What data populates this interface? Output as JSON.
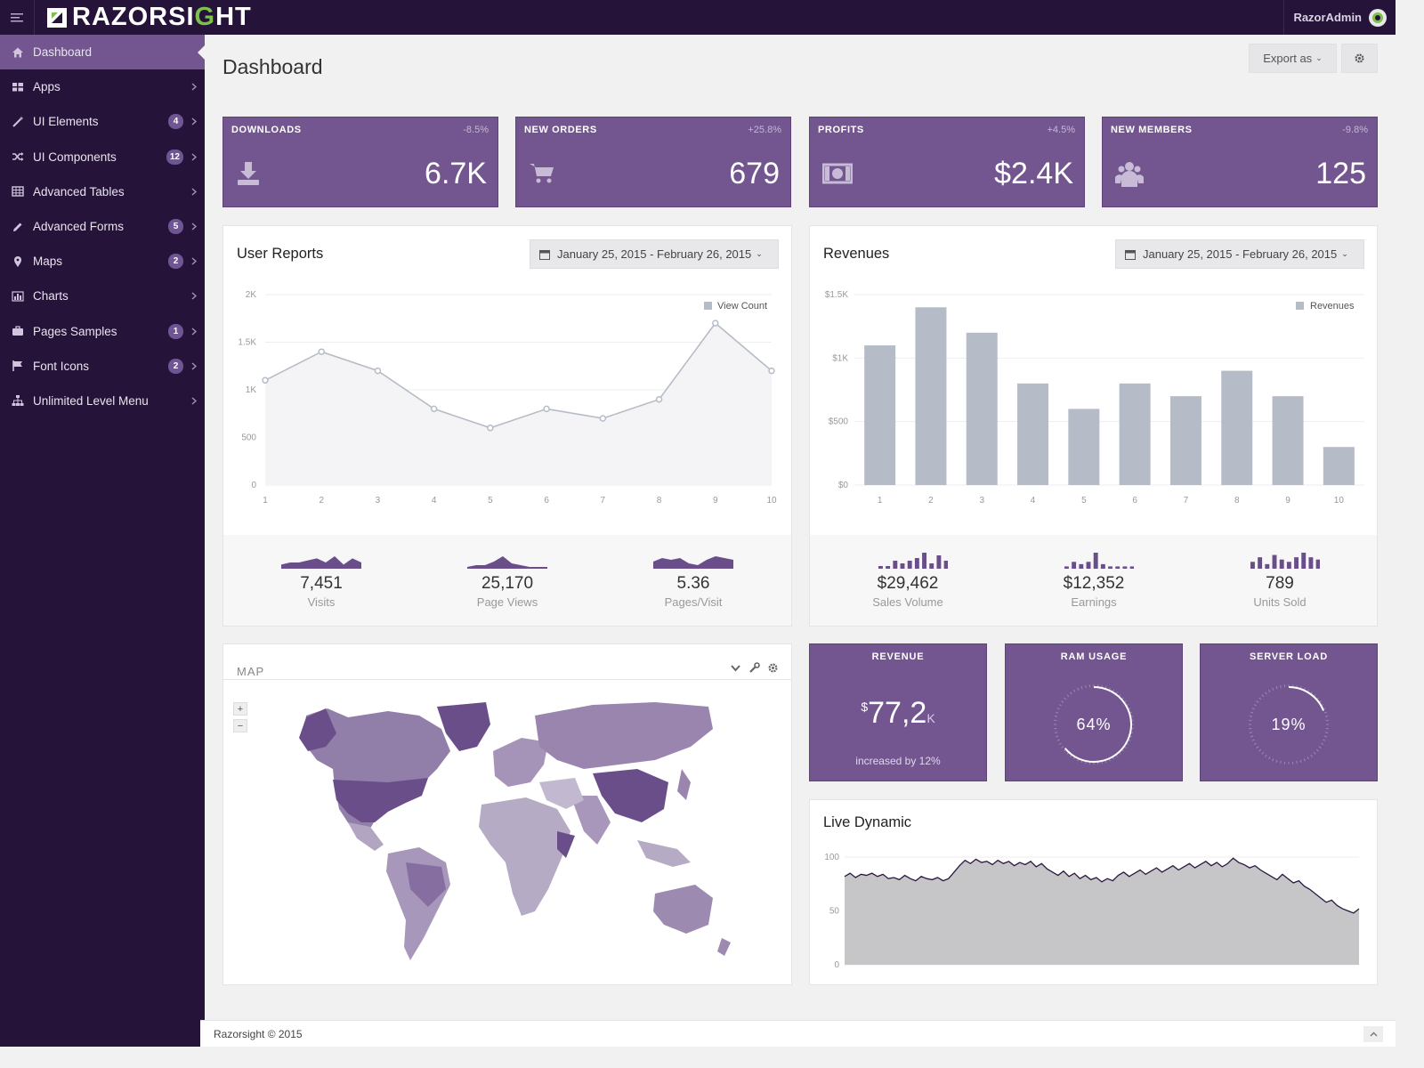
{
  "brand": {
    "name_pre": "RAZORSI",
    "name_g": "G",
    "name_post": "HT"
  },
  "user": {
    "name": "RazorAdmin"
  },
  "sidebar": {
    "items": [
      {
        "label": "Dashboard",
        "icon": "home-icon",
        "badge": "",
        "active": true
      },
      {
        "label": "Apps",
        "icon": "grid-icon",
        "badge": ""
      },
      {
        "label": "UI Elements",
        "icon": "magic-wand-icon",
        "badge": "4"
      },
      {
        "label": "UI Components",
        "icon": "shuffle-icon",
        "badge": "12"
      },
      {
        "label": "Advanced Tables",
        "icon": "table-icon",
        "badge": ""
      },
      {
        "label": "Advanced Forms",
        "icon": "pencil-icon",
        "badge": "5"
      },
      {
        "label": "Maps",
        "icon": "map-marker-icon",
        "badge": "2"
      },
      {
        "label": "Charts",
        "icon": "bar-chart-icon",
        "badge": ""
      },
      {
        "label": "Pages Samples",
        "icon": "briefcase-icon",
        "badge": "1"
      },
      {
        "label": "Font Icons",
        "icon": "flag-icon",
        "badge": "2"
      },
      {
        "label": "Unlimited Level Menu",
        "icon": "sitemap-icon",
        "badge": ""
      }
    ]
  },
  "header": {
    "title": "Dashboard",
    "export_label": "Export as"
  },
  "stats": [
    {
      "label": "DOWNLOADS",
      "change": "-8.5%",
      "value": "6.7K",
      "icon": "download-icon"
    },
    {
      "label": "NEW ORDERS",
      "change": "+25.8%",
      "value": "679",
      "icon": "cart-icon"
    },
    {
      "label": "PROFITS",
      "change": "+4.5%",
      "value": "$2.4K",
      "icon": "money-icon"
    },
    {
      "label": "NEW MEMBERS",
      "change": "-9.8%",
      "value": "125",
      "icon": "users-icon"
    }
  ],
  "user_reports": {
    "title": "User Reports",
    "date_range": "January 25, 2015 - February 26, 2015",
    "summary": [
      {
        "value": "7,451",
        "label": "Visits",
        "spark": [
          2,
          3,
          3,
          4,
          5,
          3,
          6,
          2,
          5,
          3
        ]
      },
      {
        "value": "25,170",
        "label": "Page Views",
        "spark": [
          1,
          2,
          2,
          4,
          7,
          3,
          2,
          1,
          1,
          1
        ]
      },
      {
        "value": "5.36",
        "label": "Pages/Visit",
        "spark": [
          4,
          6,
          5,
          6,
          3,
          2,
          5,
          7,
          6,
          5
        ]
      }
    ]
  },
  "revenues": {
    "title": "Revenues",
    "date_range": "January 25, 2015 - February 26, 2015",
    "summary": [
      {
        "value": "$29,462",
        "label": "Sales Volume",
        "spark": [
          1,
          1,
          3,
          2,
          3,
          4,
          6,
          2,
          5,
          3,
          1
        ]
      },
      {
        "value": "$12,352",
        "label": "Earnings",
        "spark": [
          1,
          3,
          2,
          3,
          7,
          2,
          1,
          1,
          1,
          1,
          1
        ]
      },
      {
        "value": "789",
        "label": "Units Sold",
        "spark": [
          3,
          5,
          2,
          6,
          4,
          3,
          5,
          7,
          5,
          4,
          3
        ]
      }
    ]
  },
  "map": {
    "title": "MAP",
    "zoom_in": "+",
    "zoom_out": "−"
  },
  "tiles": {
    "revenue": {
      "label": "REVENUE",
      "currency": "$",
      "value": "77,2",
      "unit": "K",
      "note": "increased by 12%"
    },
    "ram": {
      "label": "RAM USAGE",
      "value": "64%",
      "percent": 64
    },
    "server": {
      "label": "SERVER LOAD",
      "value": "19%",
      "percent": 19
    }
  },
  "live": {
    "title": "Live Dynamic"
  },
  "footer": {
    "text": "Razorsight © 2015"
  },
  "colors": {
    "accent": "#735690",
    "sidebar": "#261339",
    "bar": "#b6bcc7"
  },
  "chart_data": [
    {
      "type": "line",
      "title": "User Reports",
      "x": [
        1,
        2,
        3,
        4,
        5,
        6,
        7,
        8,
        9,
        10
      ],
      "series": [
        {
          "name": "View Count",
          "values": [
            1100,
            1400,
            1200,
            800,
            600,
            800,
            700,
            900,
            1700,
            1200
          ]
        }
      ],
      "ylim": [
        0,
        2000
      ],
      "yticks": [
        "0",
        "500",
        "1K",
        "1.5K",
        "2K"
      ],
      "legend": "top-right",
      "grid": true
    },
    {
      "type": "bar",
      "title": "Revenues",
      "categories": [
        "1",
        "2",
        "3",
        "4",
        "5",
        "6",
        "7",
        "8",
        "9",
        "10"
      ],
      "series": [
        {
          "name": "Revenues",
          "values": [
            1100,
            1400,
            1200,
            800,
            600,
            800,
            700,
            900,
            700,
            300
          ]
        }
      ],
      "ylim": [
        0,
        1500
      ],
      "yticks": [
        "$0",
        "$500",
        "$1K",
        "$1.5K"
      ],
      "legend": "top-right",
      "grid": true
    },
    {
      "type": "area",
      "title": "Live Dynamic",
      "ylim": [
        0,
        100
      ],
      "yticks": [
        "0",
        "50",
        "100"
      ],
      "values": [
        82,
        85,
        81,
        84,
        83,
        85,
        82,
        84,
        80,
        81,
        79,
        83,
        80,
        78,
        82,
        80,
        79,
        81,
        78,
        80,
        86,
        92,
        97,
        94,
        98,
        95,
        96,
        93,
        97,
        94,
        96,
        92,
        95,
        93,
        96,
        91,
        94,
        89,
        86,
        83,
        87,
        82,
        85,
        80,
        83,
        79,
        81,
        77,
        80,
        78,
        83,
        86,
        82,
        85,
        88,
        84,
        87,
        90,
        86,
        89,
        92,
        88,
        91,
        94,
        90,
        93,
        96,
        92,
        95,
        91,
        94,
        99,
        95,
        93,
        90,
        92,
        88,
        85,
        82,
        79,
        84,
        80,
        76,
        78,
        73,
        70,
        66,
        62,
        58,
        60,
        55,
        52,
        50,
        48,
        52
      ]
    }
  ]
}
